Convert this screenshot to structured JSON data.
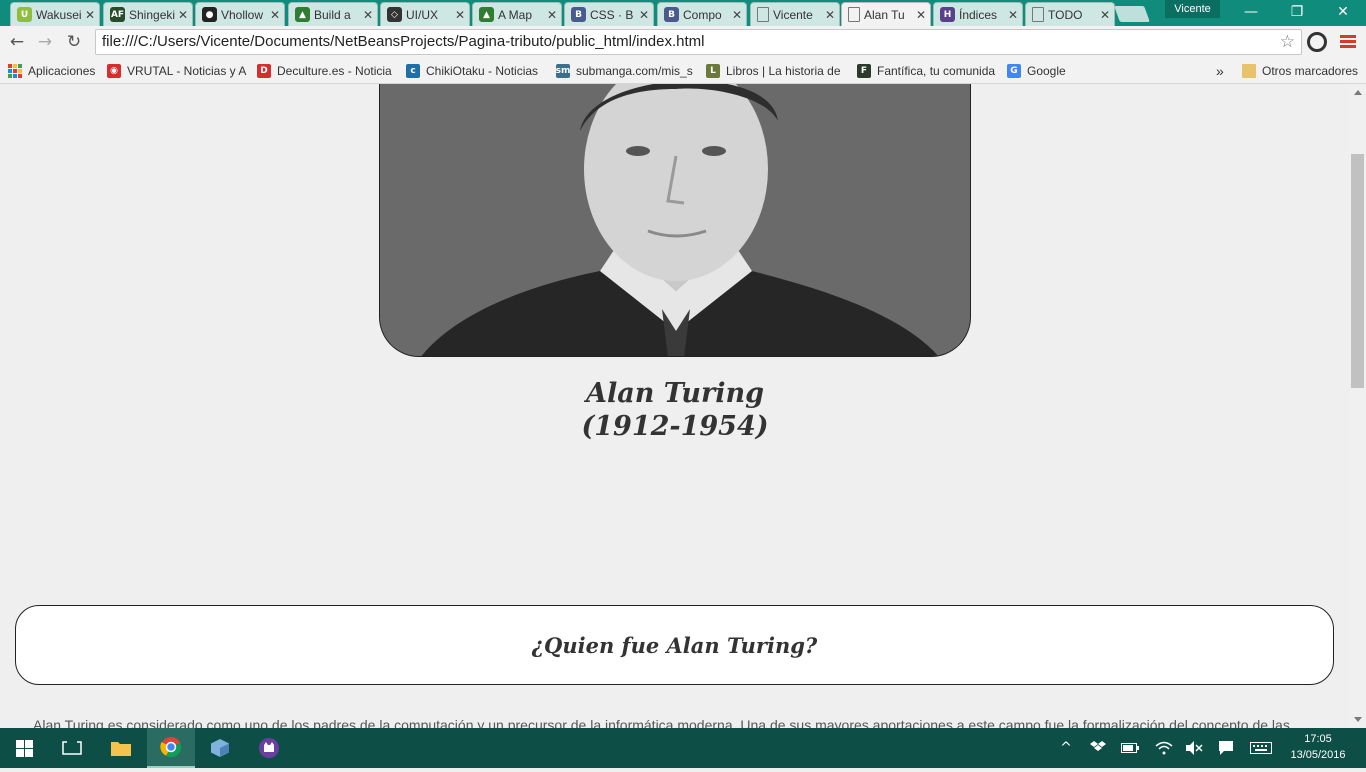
{
  "browser": {
    "tabs": [
      {
        "title": "Wakusei",
        "icon": "U",
        "color": "#8fbf3a"
      },
      {
        "title": "Shingeki",
        "icon": "AF",
        "color": "#2b4a2b"
      },
      {
        "title": "Vhollow",
        "icon": "github",
        "color": "#222222"
      },
      {
        "title": "Build a",
        "icon": "fcc",
        "color": "#2f7d32"
      },
      {
        "title": "UI/UX",
        "icon": "codepen",
        "color": "#333333"
      },
      {
        "title": "A Map",
        "icon": "fcc",
        "color": "#2f7d32"
      },
      {
        "title": "CSS · B",
        "icon": "B",
        "color": "#4a5a8c"
      },
      {
        "title": "Compo",
        "icon": "B",
        "color": "#4a5a8c"
      },
      {
        "title": "Vicente",
        "icon": "doc",
        "color": "#777777"
      },
      {
        "title": "Alan Tu",
        "icon": "doc",
        "color": "#777777",
        "active": true
      },
      {
        "title": "Índices",
        "icon": "H",
        "color": "#5b3f8c"
      },
      {
        "title": "TODO",
        "icon": "doc",
        "color": "#777777"
      }
    ],
    "profile_name": "Vicente",
    "window_controls": {
      "minimize": "—",
      "restore": "❐",
      "close": "✕"
    },
    "url": "file:///C:/Users/Vicente/Documents/NetBeansProjects/Pagina-tributo/public_html/index.html",
    "nav": {
      "back": "←",
      "forward": "→",
      "reload": "↻",
      "star": "☆"
    },
    "bookmarks": [
      {
        "label": "Aplicaciones",
        "icon": "apps"
      },
      {
        "label": "VRUTAL - Noticias y A",
        "icon": "vr",
        "color": "#d32f2f"
      },
      {
        "label": "Deculture.es - Noticia",
        "icon": "D",
        "color": "#d32f2f"
      },
      {
        "label": "ChikiOtaku - Noticias",
        "icon": "c",
        "color": "#1e6fa8"
      },
      {
        "label": "submanga.com/mis_s",
        "icon": "sm",
        "color": "#3b6f8c"
      },
      {
        "label": "Libros | La historia de",
        "icon": "L",
        "color": "#6b7a3a"
      },
      {
        "label": "Fantífica, tu comunida",
        "icon": "F",
        "color": "#2b3a2b"
      },
      {
        "label": "Google",
        "icon": "G",
        "color": "#4285f4"
      }
    ],
    "bookmarks_overflow": "»",
    "other_bookmarks": "Otros marcadores"
  },
  "page": {
    "portrait_alt": "Alan Turing portrait",
    "name": "Alan Turing",
    "years": "(1912-1954)",
    "question": "¿Quien fue Alan Turing?",
    "paragraph": "Alan Turing es considerado como uno de los padres de la computación y un precursor de la informática moderna. Una de sus mayores aportaciones a este campo fue la formalización del concepto de las"
  },
  "taskbar": {
    "clock_time": "17:05",
    "clock_date": "13/05/2016",
    "tray": {
      "chevron": "^",
      "volume": "🔇",
      "notifications": "▤"
    }
  }
}
